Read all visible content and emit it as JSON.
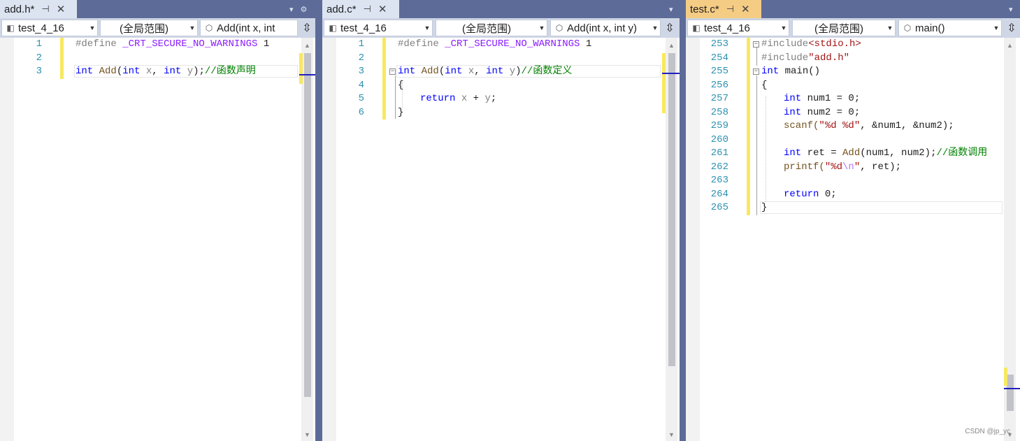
{
  "panes": [
    {
      "tab": {
        "title": "add.h*",
        "pin": "⊣",
        "close": "✕"
      },
      "tabbar_icons": {
        "dropdown": "▾",
        "settings": "⚙"
      },
      "nav": {
        "project": "test_4_16",
        "scope": "(全局范围)",
        "member": "Add(int x, int"
      },
      "lines": [
        {
          "num": "1"
        },
        {
          "num": "2"
        },
        {
          "num": "3"
        }
      ]
    },
    {
      "tab": {
        "title": "add.c*",
        "pin": "⊣",
        "close": "✕"
      },
      "tabbar_icons": {
        "dropdown": "▾"
      },
      "nav": {
        "project": "test_4_16",
        "scope": "(全局范围)",
        "member": "Add(int x, int y)"
      },
      "lines": [
        {
          "num": "1"
        },
        {
          "num": "2"
        },
        {
          "num": "3"
        },
        {
          "num": "4"
        },
        {
          "num": "5"
        },
        {
          "num": "6"
        }
      ]
    },
    {
      "tab": {
        "title": "test.c*",
        "pin": "⊣",
        "close": "✕"
      },
      "tabbar_icons": {
        "dropdown": "▾"
      },
      "nav": {
        "project": "test_4_16",
        "scope": "(全局范围)",
        "member": "main()"
      },
      "lines": [
        {
          "num": "253"
        },
        {
          "num": "254"
        },
        {
          "num": "255"
        },
        {
          "num": "256"
        },
        {
          "num": "257"
        },
        {
          "num": "258"
        },
        {
          "num": "259"
        },
        {
          "num": "260"
        },
        {
          "num": "261"
        },
        {
          "num": "262"
        },
        {
          "num": "263"
        },
        {
          "num": "264"
        },
        {
          "num": "265"
        }
      ]
    }
  ],
  "code": {
    "p1": {
      "l1a": "#define",
      "l1b": " _CRT_SECURE_NO_WARNINGS",
      "l1c": " 1",
      "l3a": "int",
      "l3b": " Add",
      "l3c": "(",
      "l3d": "int",
      "l3e": " x",
      "l3f": ", ",
      "l3g": "int",
      "l3h": " y",
      "l3i": ");",
      "l3j": "//函数声明"
    },
    "p2": {
      "l1a": "#define",
      "l1b": " _CRT_SECURE_NO_WARNINGS",
      "l1c": " 1",
      "l3a": "int",
      "l3b": " Add",
      "l3c": "(",
      "l3d": "int",
      "l3e": " x",
      "l3f": ", ",
      "l3g": "int",
      "l3h": " y",
      "l3i": ")",
      "l3j": "//函数定义",
      "l4": "{",
      "l5a": "return",
      "l5b": " x",
      "l5c": " + ",
      "l5d": "y",
      "l5e": ";",
      "l6": "}"
    },
    "p3": {
      "l253a": "#include",
      "l253b": "<stdio.h>",
      "l254a": "#include",
      "l254b": "\"add.h\"",
      "l255a": "int",
      "l255b": " main",
      "l255c": "()",
      "l256": "{",
      "l257a": "int",
      "l257b": " num1 = 0;",
      "l258a": "int",
      "l258b": " num2 = 0;",
      "l259a": "scanf(",
      "l259b": "\"%d %d\"",
      "l259c": ", &num1, &num2);",
      "l261a": "int",
      "l261b": " ret = ",
      "l261c": "Add",
      "l261d": "(num1, num2);",
      "l261e": "//函数调用",
      "l262a": "printf(",
      "l262b": "\"%d",
      "l262c": "\\n",
      "l262d": "\"",
      "l262e": ", ret);",
      "l264a": "return",
      "l264b": " 0;",
      "l265": "}"
    }
  },
  "watermark": "CSDN @jp_yc",
  "colors": {
    "keyword": "#0000ff",
    "comment": "#008000",
    "macro": "#8a1bff",
    "string": "#a31515",
    "line_number": "#2b91af",
    "change_bar": "#f8e860",
    "active_tab": "#f5cc84"
  }
}
